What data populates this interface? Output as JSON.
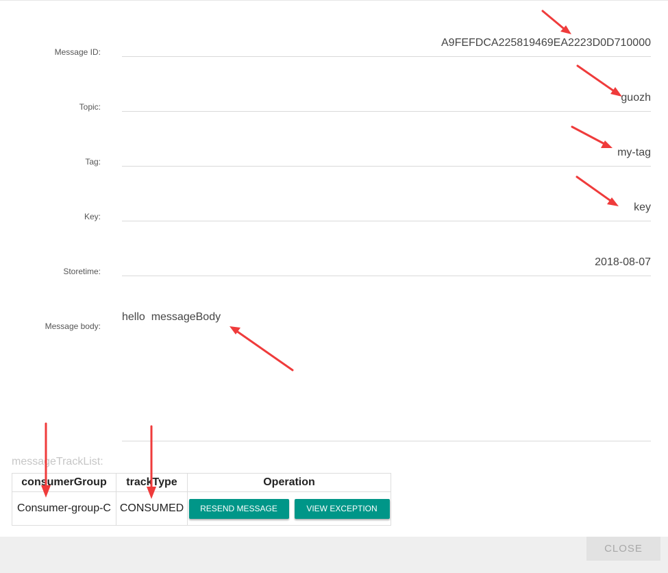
{
  "fields": [
    {
      "label": "Message ID:",
      "value": "A9FEFDCA225819469EA2223D0D710000"
    },
    {
      "label": "Topic:",
      "value": "guozh"
    },
    {
      "label": "Tag:",
      "value": "my-tag"
    },
    {
      "label": "Key:",
      "value": "key"
    },
    {
      "label": "Storetime:",
      "value": "2018-08-07"
    }
  ],
  "body": {
    "label": "Message body:",
    "value": "hello  messageBody"
  },
  "track": {
    "label": "messageTrackList:",
    "headers": [
      "consumerGroup",
      "trackType",
      "Operation"
    ],
    "rows": [
      {
        "consumerGroup": "Consumer-group-C",
        "trackType": "CONSUMED",
        "resend": "RESEND MESSAGE",
        "exception": "VIEW EXCEPTION"
      }
    ]
  },
  "footer": {
    "close": "CLOSE"
  },
  "colors": {
    "button": "#009688",
    "arrow": "#ef3b3b"
  }
}
